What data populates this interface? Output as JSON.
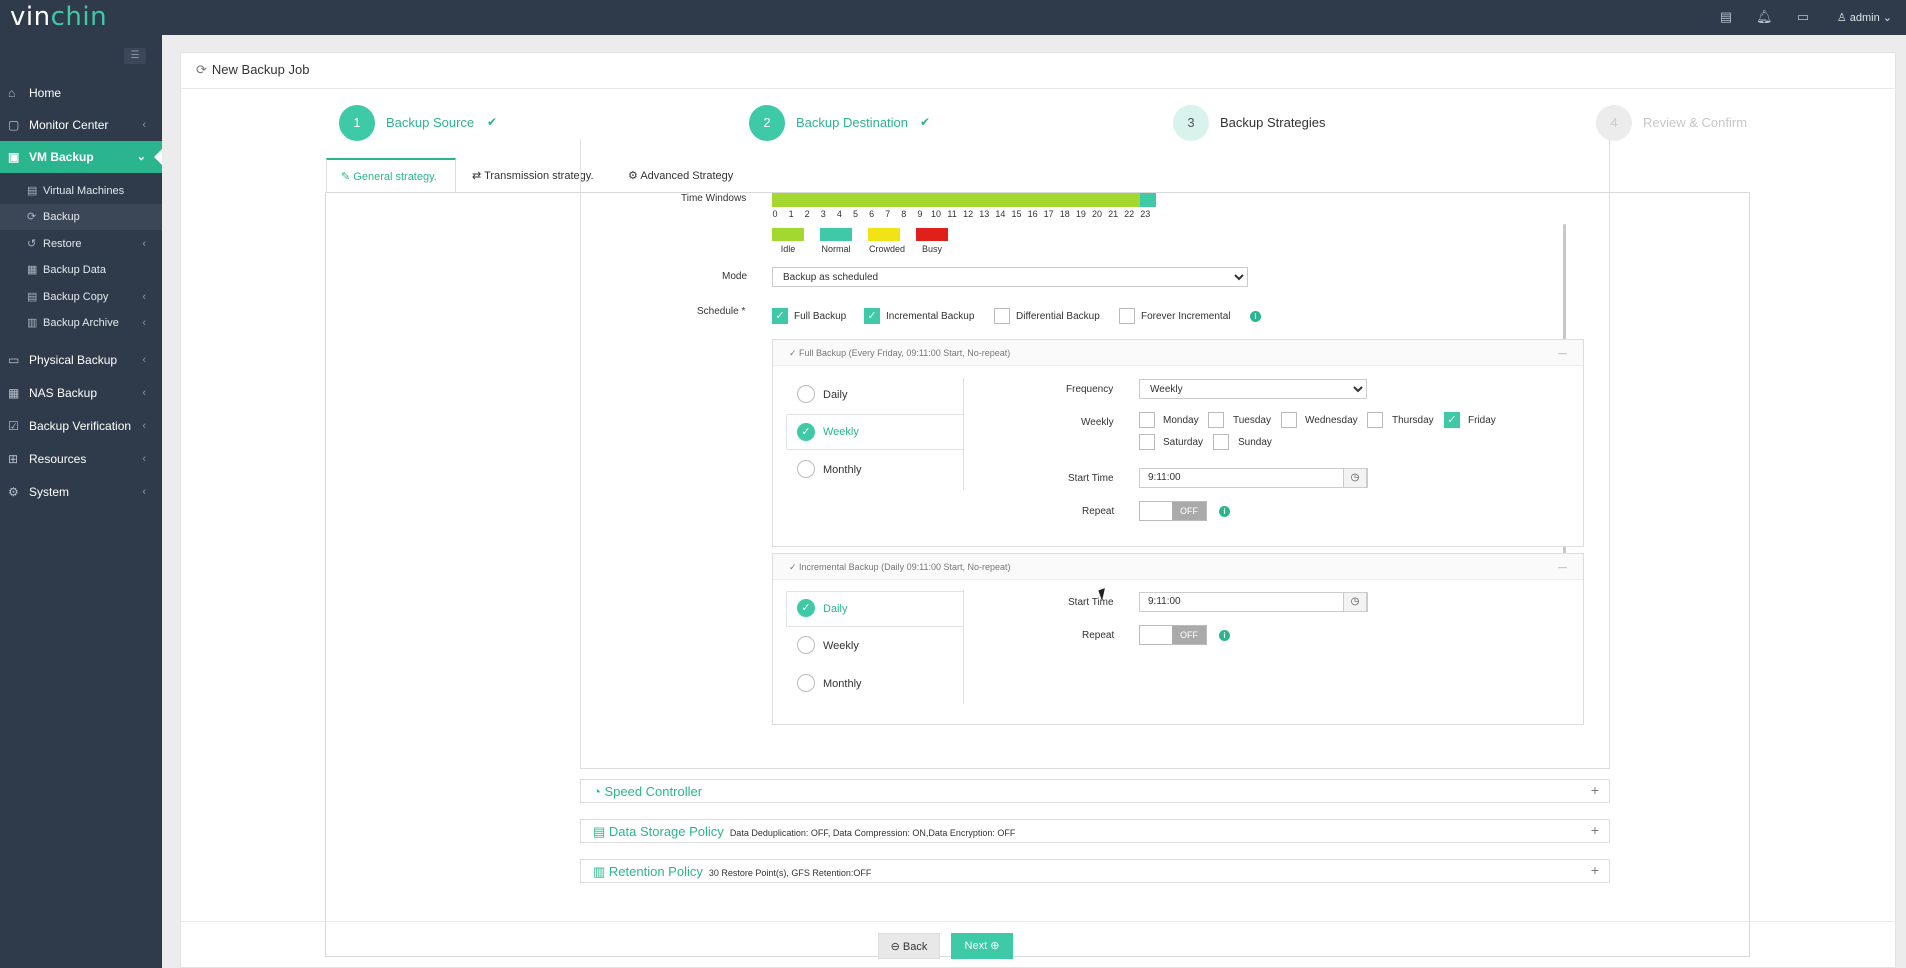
{
  "brand": {
    "name_a": "vin",
    "name_b": "chin"
  },
  "topbar": {
    "user": "admin",
    "user_caret": "⌄"
  },
  "sidebar": {
    "toggle_icon": "list-icon",
    "items": [
      {
        "label": "Home",
        "icon": "home-icon"
      },
      {
        "label": "Monitor Center",
        "icon": "monitor-icon",
        "arrow": "‹"
      },
      {
        "label": "VM Backup",
        "icon": "vm-icon",
        "arrow": "⌄"
      },
      {
        "label": "Physical Backup",
        "icon": "server-icon",
        "arrow": "‹"
      },
      {
        "label": "NAS Backup",
        "icon": "nas-icon",
        "arrow": "‹"
      },
      {
        "label": "Backup Verification",
        "icon": "verify-icon",
        "arrow": "‹"
      },
      {
        "label": "Resources",
        "icon": "resources-icon",
        "arrow": "‹"
      },
      {
        "label": "System",
        "icon": "system-icon",
        "arrow": "‹"
      }
    ],
    "sub_items": [
      {
        "label": "Virtual Machines"
      },
      {
        "label": "Backup"
      },
      {
        "label": "Restore",
        "arrow": "‹"
      },
      {
        "label": "Backup Data"
      },
      {
        "label": "Backup Copy",
        "arrow": "‹"
      },
      {
        "label": "Backup Archive",
        "arrow": "‹"
      }
    ]
  },
  "page": {
    "title": "New Backup Job"
  },
  "steps": [
    {
      "num": "1",
      "label": "Backup Source",
      "check": "✔"
    },
    {
      "num": "2",
      "label": "Backup Destination",
      "check": "✔"
    },
    {
      "num": "3",
      "label": "Backup Strategies"
    },
    {
      "num": "4",
      "label": "Review & Confirm"
    }
  ],
  "tabs": [
    {
      "label": "General strategy."
    },
    {
      "label": "Transmission strategy."
    },
    {
      "label": "Advanced Strategy"
    }
  ],
  "time_windows": {
    "label": "Time Windows",
    "hours": [
      "0",
      "1",
      "2",
      "3",
      "4",
      "5",
      "6",
      "7",
      "8",
      "9",
      "10",
      "11",
      "12",
      "13",
      "14",
      "15",
      "16",
      "17",
      "18",
      "19",
      "20",
      "21",
      "22",
      "23"
    ],
    "legend": [
      {
        "label": "Idle",
        "color": "#a3d831"
      },
      {
        "label": "Normal",
        "color": "#3ec9a7"
      },
      {
        "label": "Crowded",
        "color": "#f2e316"
      },
      {
        "label": "Busy",
        "color": "#e0201b"
      }
    ]
  },
  "mode": {
    "label": "Mode",
    "value": "Backup as scheduled"
  },
  "schedule": {
    "label": "Schedule *",
    "options": [
      {
        "label": "Full Backup",
        "checked": true
      },
      {
        "label": "Incremental Backup",
        "checked": true
      },
      {
        "label": "Differential Backup",
        "checked": false
      },
      {
        "label": "Forever Incremental",
        "checked": false
      }
    ]
  },
  "full_backup": {
    "header": "Full Backup (Every Friday, 09:11:00 Start, No-repeat)",
    "collapse": "—",
    "types": [
      "Daily",
      "Weekly",
      "Monthly"
    ],
    "frequency_label": "Frequency",
    "frequency_value": "Weekly",
    "weekly_label": "Weekly",
    "days": [
      {
        "label": "Monday",
        "checked": false
      },
      {
        "label": "Tuesday",
        "checked": false
      },
      {
        "label": "Wednesday",
        "checked": false
      },
      {
        "label": "Thursday",
        "checked": false
      },
      {
        "label": "Friday",
        "checked": true
      },
      {
        "label": "Saturday",
        "checked": false
      },
      {
        "label": "Sunday",
        "checked": false
      }
    ],
    "start_time_label": "Start Time",
    "start_time": "9:11:00",
    "repeat_label": "Repeat",
    "repeat_state": "OFF"
  },
  "incremental_backup": {
    "header": "Incremental Backup (Daily 09:11:00 Start, No-repeat)",
    "collapse": "—",
    "types": [
      "Daily",
      "Weekly",
      "Monthly"
    ],
    "start_time_label": "Start Time",
    "start_time": "9:11:00",
    "repeat_label": "Repeat",
    "repeat_state": "OFF"
  },
  "sections": [
    {
      "title": "Speed Controller",
      "desc": "",
      "icon": "speed-icon"
    },
    {
      "title": "Data Storage Policy",
      "desc": "Data Deduplication: OFF, Data Compression: ON,Data Encryption: OFF",
      "icon": "storage-icon"
    },
    {
      "title": "Retention Policy",
      "desc": "30 Restore Point(s), GFS Retention:OFF",
      "icon": "retention-icon"
    }
  ],
  "footer": {
    "back": "Back",
    "next": "Next"
  },
  "colors": {
    "accent": "#2bb58f",
    "sidebar": "#2f3a4a"
  }
}
